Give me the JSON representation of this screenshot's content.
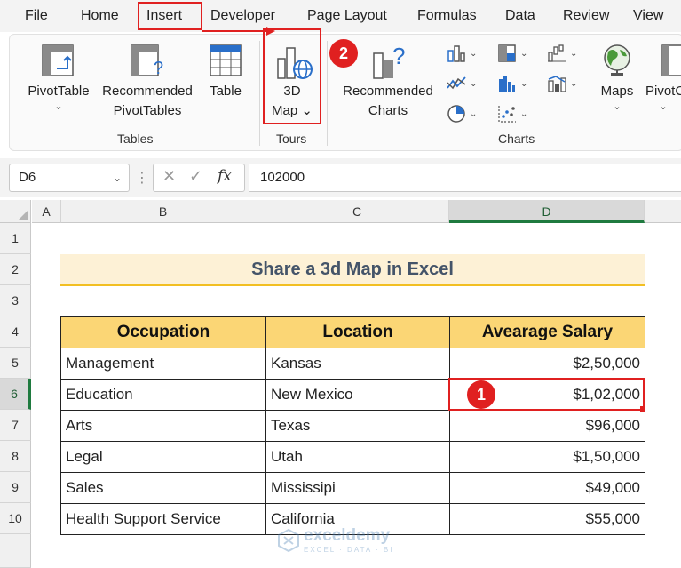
{
  "menu": {
    "items": [
      "File",
      "Home",
      "Insert",
      "Developer",
      "Page Layout",
      "Formulas",
      "Data",
      "Review",
      "View"
    ]
  },
  "ribbon": {
    "pivot_table": "PivotTable",
    "recommended_pivot_line1": "Recommended",
    "recommended_pivot_line2": "PivotTables",
    "table": "Table",
    "map3d_line1": "3D",
    "map3d_line2": "Map",
    "recommended_charts_line1": "Recommended",
    "recommended_charts_line2": "Charts",
    "maps": "Maps",
    "pivot_chart_partial": "PivotC",
    "groups": {
      "tables": "Tables",
      "tours": "Tours",
      "charts": "Charts"
    }
  },
  "callouts": {
    "step1": "1",
    "step2": "2"
  },
  "formula_bar": {
    "name_box": "D6",
    "fx": "fx",
    "value": "102000"
  },
  "columns": [
    "A",
    "B",
    "C",
    "D"
  ],
  "rows": [
    "1",
    "2",
    "3",
    "4",
    "5",
    "6",
    "7",
    "8",
    "9",
    "10"
  ],
  "sheet": {
    "title": "Share a 3d Map in Excel",
    "headers": [
      "Occupation",
      "Location",
      "Avearage Salary"
    ],
    "rows": [
      [
        "Management",
        "Kansas",
        "$2,50,000"
      ],
      [
        "Education",
        "New Mexico",
        "$1,02,000"
      ],
      [
        "Arts",
        "Texas",
        "$96,000"
      ],
      [
        "Legal",
        "Utah",
        "$1,50,000"
      ],
      [
        "Sales",
        "Mississipi",
        "$49,000"
      ],
      [
        "Health Support Service",
        "California",
        "$55,000"
      ]
    ]
  },
  "watermark": {
    "name": "exceldemy",
    "tagline": "EXCEL · DATA · BI"
  },
  "colors": {
    "accent_red": "#e02020",
    "header_fill": "#fbd675",
    "title_fill": "#fdf1d6",
    "title_underline": "#f2bf22",
    "selection_green": "#1f7a3f"
  }
}
